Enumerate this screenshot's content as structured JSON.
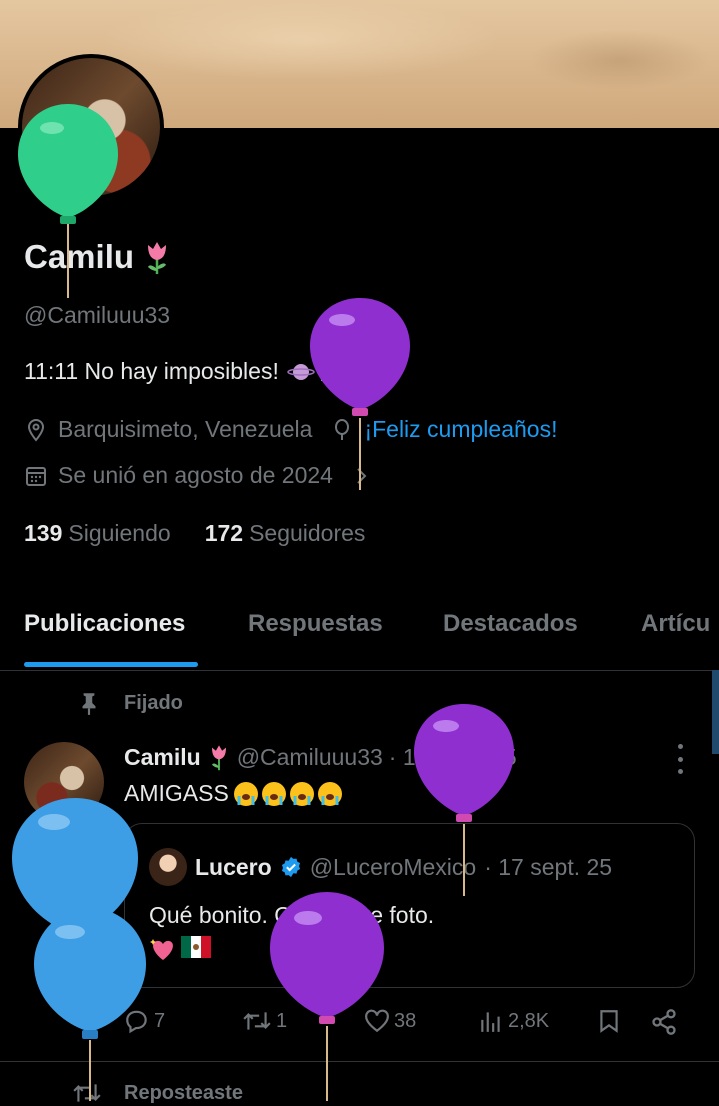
{
  "profile": {
    "name": "Camilu",
    "handle": "@Camiluuu33",
    "bio": "11:11 No hay imposibles!",
    "location": "Barquisimeto, Venezuela",
    "birthday_link": "¡Feliz cumpleaños!",
    "joined": "Se unió en agosto de 2024",
    "following_count": "139",
    "following_label": "Siguiendo",
    "followers_count": "172",
    "followers_label": "Seguidores"
  },
  "tabs": [
    "Publicaciones",
    "Respuestas",
    "Destacados",
    "Artícu"
  ],
  "pinned_label": "Fijado",
  "post": {
    "name": "Camilu",
    "handle": "@Camiluuu33",
    "date": "· 17 sept. 25",
    "text": "AMIGASS",
    "quote": {
      "name": "Lucero",
      "handle": "@LuceroMexico",
      "date": "· 17 sept. 25",
      "text": "Qué bonito. Qué padre foto."
    },
    "replies": "7",
    "reposts": "1",
    "likes": "38",
    "views": "2,8K"
  },
  "reposted_label": "Reposteaste",
  "colors": {
    "accent": "#1d9bf0",
    "muted": "#71767b",
    "balloon_green": "#2fce8a",
    "balloon_purple": "#8f2fd0",
    "balloon_blue": "#3d9ee6"
  }
}
